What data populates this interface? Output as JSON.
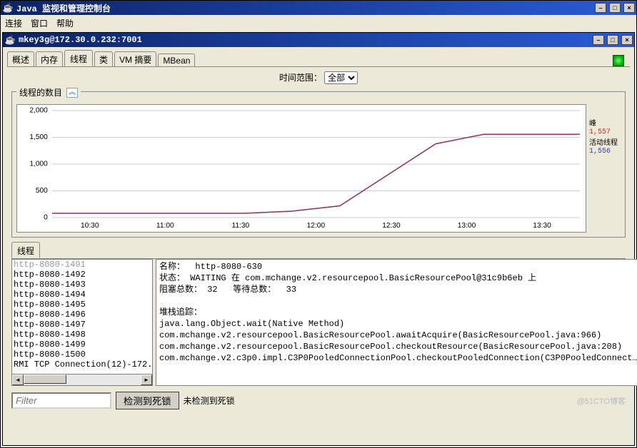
{
  "outer": {
    "title": "Java 监视和管理控制台"
  },
  "menubar": [
    "连接",
    "窗口",
    "帮助"
  ],
  "inner": {
    "title": "mkey3g@172.30.0.232:7001"
  },
  "tabs": [
    "概述",
    "内存",
    "线程",
    "类",
    "VM 摘要",
    "MBean"
  ],
  "active_tab": 2,
  "time_range": {
    "label": "时间范围：",
    "value": "全部"
  },
  "chart": {
    "group_title": "线程的数目",
    "side": {
      "peak_label": "峰",
      "peak": "1,557",
      "active_label": "活动线程",
      "active": "1,556"
    }
  },
  "threads_tab_label": "线程",
  "thread_list": [
    "http-8080-1491",
    "http-8080-1492",
    "http-8080-1493",
    "http-8080-1494",
    "http-8080-1495",
    "http-8080-1496",
    "http-8080-1497",
    "http-8080-1498",
    "http-8080-1499",
    "http-8080-1500",
    "RMI TCP Connection(12)-172.30.…"
  ],
  "detail": {
    "name_lbl": "名称：",
    "name_val": "http-8080-630",
    "state_lbl": "状态：",
    "state_val": "WAITING 在 com.mchange.v2.resourcepool.BasicResourcePool@31c9b6eb 上",
    "blocked_lbl": "阻塞总数：",
    "blocked_val": "32",
    "waiting_lbl": "等待总数：",
    "waiting_val": "33",
    "stack_lbl": "堆栈追踪：",
    "stack": [
      "java.lang.Object.wait(Native Method)",
      "com.mchange.v2.resourcepool.BasicResourcePool.awaitAcquire(BasicResourcePool.java:966)",
      "com.mchange.v2.resourcepool.BasicResourcePool.checkoutResource(BasicResourcePool.java:208)",
      "com.mchange.v2.c3p0.impl.C3P0PooledConnectionPool.checkoutPooledConnection(C3P0PooledConnect…"
    ]
  },
  "filter": {
    "placeholder": "Filter",
    "btn_detect": "检测到死锁",
    "btn_none": "未检测到死锁"
  },
  "watermark": "@51CTO博客",
  "chart_data": {
    "type": "line",
    "title": "线程的数目",
    "xlabel": "",
    "ylabel": "",
    "ylim": [
      0,
      2000
    ],
    "yticks": [
      0,
      500,
      1000,
      1500,
      2000
    ],
    "xticks": [
      "10:30",
      "11:00",
      "11:30",
      "12:00",
      "12:30",
      "13:00",
      "13:30"
    ],
    "x": [
      "10:10",
      "10:30",
      "11:00",
      "11:30",
      "11:55",
      "12:00",
      "12:05",
      "12:30",
      "13:00",
      "13:10",
      "13:30",
      "13:40"
    ],
    "series": [
      {
        "name": "活动线程",
        "values": [
          80,
          80,
          80,
          80,
          80,
          120,
          220,
          800,
          1380,
          1556,
          1556,
          1556
        ]
      },
      {
        "name": "峰",
        "values": [
          80,
          80,
          80,
          80,
          80,
          120,
          220,
          800,
          1380,
          1557,
          1557,
          1557
        ]
      }
    ]
  }
}
